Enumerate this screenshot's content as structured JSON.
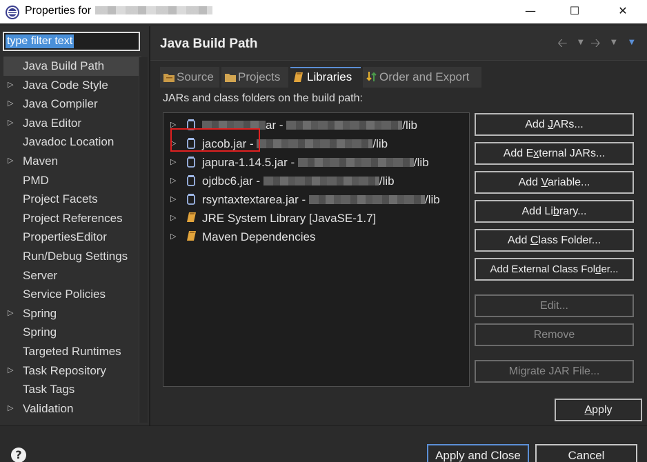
{
  "window": {
    "title_prefix": "Properties for",
    "minimize_glyph": "—",
    "maximize_glyph": "☐",
    "close_glyph": "✕"
  },
  "filter": {
    "value": "type filter text"
  },
  "sidebar": {
    "items": [
      {
        "label": "Java Build Path",
        "expandable": false,
        "selected": true
      },
      {
        "label": "Java Code Style",
        "expandable": true
      },
      {
        "label": "Java Compiler",
        "expandable": true
      },
      {
        "label": "Java Editor",
        "expandable": true
      },
      {
        "label": "Javadoc Location",
        "expandable": false
      },
      {
        "label": "Maven",
        "expandable": true
      },
      {
        "label": "PMD",
        "expandable": false
      },
      {
        "label": "Project Facets",
        "expandable": false
      },
      {
        "label": "Project References",
        "expandable": false
      },
      {
        "label": "PropertiesEditor",
        "expandable": false
      },
      {
        "label": "Run/Debug Settings",
        "expandable": false
      },
      {
        "label": "Server",
        "expandable": false
      },
      {
        "label": "Service Policies",
        "expandable": false
      },
      {
        "label": "Spring",
        "expandable": true
      },
      {
        "label": "Spring",
        "expandable": false
      },
      {
        "label": "Targeted Runtimes",
        "expandable": false
      },
      {
        "label": "Task Repository",
        "expandable": true
      },
      {
        "label": "Task Tags",
        "expandable": false
      },
      {
        "label": "Validation",
        "expandable": true
      }
    ]
  },
  "page": {
    "title": "Java Build Path",
    "section_label": "JARs and class folders on the build path:"
  },
  "tabs": [
    {
      "label": "Source",
      "icon": "source-folder-icon",
      "active": false
    },
    {
      "label": "Projects",
      "icon": "projects-folder-icon",
      "active": false
    },
    {
      "label": "Libraries",
      "icon": "library-book-icon",
      "active": true
    },
    {
      "label": "Order and Export",
      "icon": "order-arrows-icon",
      "active": false
    }
  ],
  "libraries": [
    {
      "name_suffix": "ar -",
      "path_suffix": "/lib",
      "icon": "jar-icon"
    },
    {
      "name": "jacob.jar -",
      "path_suffix": "/lib",
      "icon": "jar-icon"
    },
    {
      "name": "japura-1.14.5.jar -",
      "path_suffix": "/lib",
      "icon": "jar-icon"
    },
    {
      "name": "ojdbc6.jar -",
      "path_suffix": "/lib",
      "icon": "jar-icon"
    },
    {
      "name": "rsyntaxtextarea.jar -",
      "path_suffix": "/lib",
      "icon": "jar-icon"
    },
    {
      "name": "JRE System Library [JavaSE-1.7]",
      "icon": "library-icon"
    },
    {
      "name": "Maven Dependencies",
      "icon": "library-icon"
    }
  ],
  "buttons": {
    "add_jars": {
      "pre": "Add ",
      "mn": "J",
      "post": "ARs..."
    },
    "add_external_jars": {
      "pre": "Add E",
      "mn": "x",
      "post": "ternal JARs..."
    },
    "add_variable": {
      "pre": "Add ",
      "mn": "V",
      "post": "ariable..."
    },
    "add_library": {
      "pre": "Add Li",
      "mn": "b",
      "post": "rary..."
    },
    "add_class_folder": {
      "pre": "Add ",
      "mn": "C",
      "post": "lass Folder..."
    },
    "add_external_class_folder": {
      "pre": "Add External Class Fol",
      "mn": "d",
      "post": "er..."
    },
    "edit": "Edit...",
    "remove": "Remove",
    "migrate": "Migrate JAR File...",
    "apply": {
      "pre": "",
      "mn": "A",
      "post": "pply"
    }
  },
  "footer": {
    "help_glyph": "?",
    "apply_and_close": "Apply and Close",
    "cancel": "Cancel"
  },
  "colors": {
    "accent": "#5b8fd6",
    "highlight_box": "#e02020",
    "background": "#2b2b2b"
  }
}
